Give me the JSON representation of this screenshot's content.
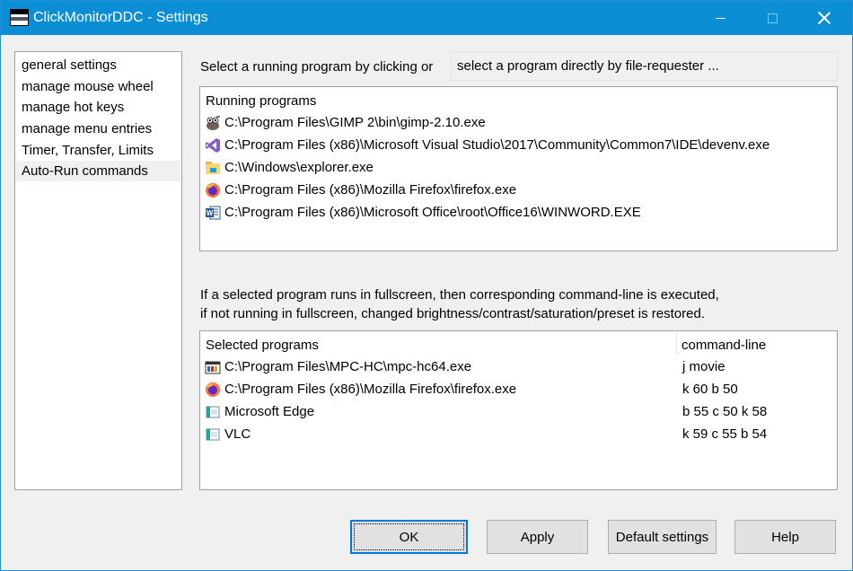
{
  "window": {
    "title": "ClickMonitorDDC - Settings"
  },
  "nav": {
    "items": [
      {
        "label": "general settings"
      },
      {
        "label": "manage mouse wheel"
      },
      {
        "label": "manage hot keys"
      },
      {
        "label": "manage menu entries"
      },
      {
        "label": "Timer, Transfer, Limits"
      },
      {
        "label": "Auto-Run commands"
      }
    ],
    "selected": "Auto-Run commands"
  },
  "running": {
    "prompt": "Select a running program by clicking or",
    "file_button": "select a program directly by file-requester ...",
    "header": "Running programs",
    "items": [
      {
        "path": "C:\\Program Files\\GIMP 2\\bin\\gimp-2.10.exe",
        "icon": "gimp-icon"
      },
      {
        "path": "C:\\Program Files (x86)\\Microsoft Visual Studio\\2017\\Community\\Common7\\IDE\\devenv.exe",
        "icon": "visual-studio-icon"
      },
      {
        "path": "C:\\Windows\\explorer.exe",
        "icon": "file-explorer-icon"
      },
      {
        "path": "C:\\Program Files (x86)\\Mozilla Firefox\\firefox.exe",
        "icon": "firefox-icon"
      },
      {
        "path": "C:\\Program Files (x86)\\Microsoft Office\\root\\Office16\\WINWORD.EXE",
        "icon": "word-icon"
      }
    ]
  },
  "info": {
    "line1": "If a selected program runs in fullscreen, then corresponding command-line is executed,",
    "line2": "if not running in fullscreen, changed brightness/contrast/saturation/preset is restored."
  },
  "selected_programs": {
    "header_program": "Selected programs",
    "header_command": "command-line",
    "items": [
      {
        "path": "C:\\Program Files\\MPC-HC\\mpc-hc64.exe",
        "command": "j movie",
        "icon": "mpc-hc-icon"
      },
      {
        "path": "C:\\Program Files (x86)\\Mozilla Firefox\\firefox.exe",
        "command": "k 60  b 50",
        "icon": "firefox-icon"
      },
      {
        "path": "Microsoft Edge",
        "command": "b 55 c 50 k 58",
        "icon": "app-icon"
      },
      {
        "path": "VLC",
        "command": "k 59 c 55 b 54",
        "icon": "app-icon"
      }
    ]
  },
  "buttons": {
    "ok": "OK",
    "apply": "Apply",
    "default": "Default settings",
    "help": "Help"
  },
  "colors": {
    "titlebar": "#0b8ed3",
    "focus_border": "#0078d7"
  }
}
